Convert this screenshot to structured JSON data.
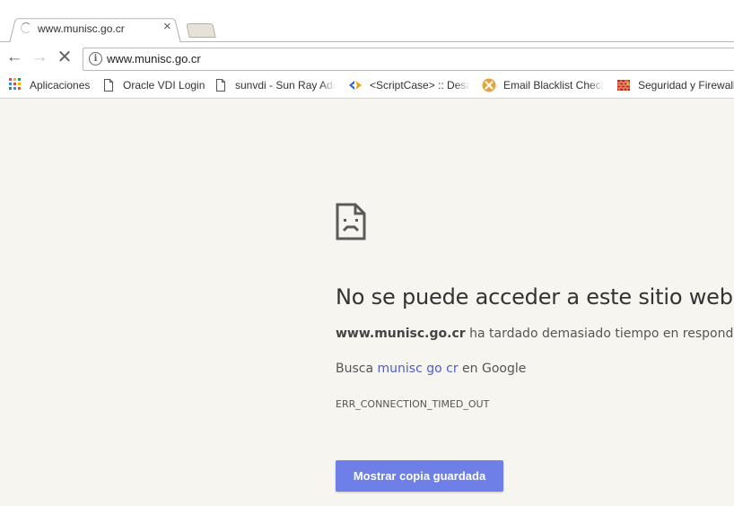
{
  "tab": {
    "title": "www.munisc.go.cr",
    "close_glyph": "×"
  },
  "toolbar": {
    "back_glyph": "←",
    "forward_glyph": "→",
    "stop_glyph": "✕",
    "url": "www.munisc.go.cr",
    "info_glyph": "i"
  },
  "bookmarks": [
    {
      "label": "Aplicaciones",
      "icon": "apps-grid-icon"
    },
    {
      "label": "Oracle VDI Login",
      "icon": "page-icon"
    },
    {
      "label": "sunvdi - Sun Ray Adm",
      "icon": "page-icon"
    },
    {
      "label": "<ScriptCase> :: Desar",
      "icon": "scriptcase-icon"
    },
    {
      "label": "Email Blacklist Check",
      "icon": "email-blacklist-icon"
    },
    {
      "label": "Seguridad y Firewall",
      "icon": "firewall-icon"
    }
  ],
  "error": {
    "heading": "No se puede acceder a este sitio web",
    "host": "www.munisc.go.cr",
    "desc_rest": " ha tardado demasiado tiempo en responder.",
    "search_prefix": "Busca ",
    "search_link": "munisc go cr",
    "search_suffix": " en Google",
    "code": "ERR_CONNECTION_TIMED_OUT",
    "button_label": "Mostrar copia guardada"
  },
  "colors": {
    "page_background": "#f7f5f0",
    "link": "#4a5ec8",
    "button": "#6e7fe8"
  }
}
